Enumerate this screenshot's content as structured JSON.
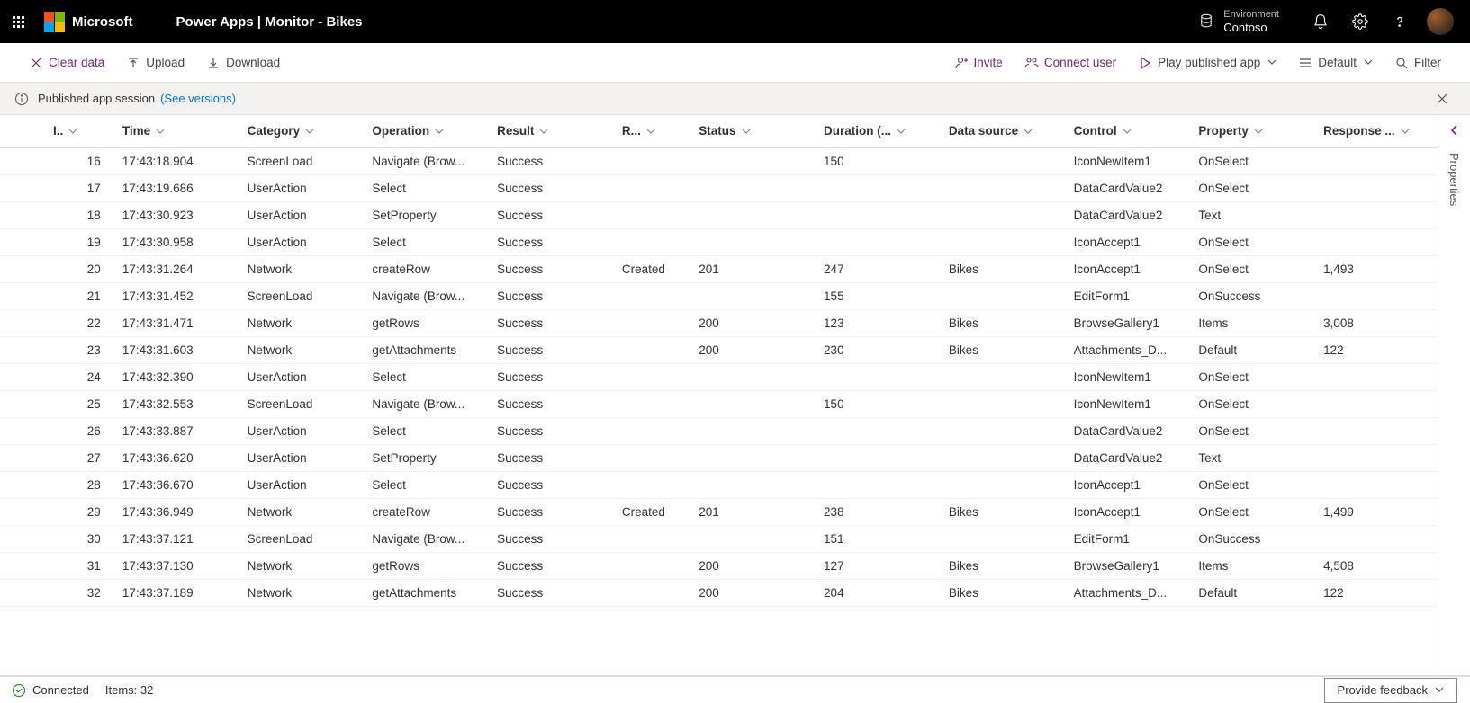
{
  "header": {
    "brand": "Microsoft",
    "app_title": "Power Apps  |  Monitor - Bikes",
    "environment_label": "Environment",
    "environment_name": "Contoso"
  },
  "command_bar": {
    "clear_data": "Clear data",
    "upload": "Upload",
    "download": "Download",
    "invite": "Invite",
    "connect_user": "Connect user",
    "play_published": "Play published app",
    "layout": "Default",
    "filter": "Filter"
  },
  "info_bar": {
    "text": "Published app session",
    "link": "(See versions)"
  },
  "properties_panel_label": "Properties",
  "table": {
    "columns": [
      {
        "key": "id",
        "label": "I.."
      },
      {
        "key": "time",
        "label": "Time"
      },
      {
        "key": "category",
        "label": "Category"
      },
      {
        "key": "operation",
        "label": "Operation"
      },
      {
        "key": "result",
        "label": "Result"
      },
      {
        "key": "resultinfo",
        "label": "R..."
      },
      {
        "key": "status",
        "label": "Status"
      },
      {
        "key": "duration",
        "label": "Duration (..."
      },
      {
        "key": "datasource",
        "label": "Data source"
      },
      {
        "key": "control",
        "label": "Control"
      },
      {
        "key": "property",
        "label": "Property"
      },
      {
        "key": "response",
        "label": "Response ..."
      }
    ],
    "rows": [
      {
        "id": "16",
        "time": "17:43:18.904",
        "category": "ScreenLoad",
        "operation": "Navigate (Brow...",
        "result": "Success",
        "resultinfo": "",
        "status": "",
        "duration": "150",
        "datasource": "",
        "control": "IconNewItem1",
        "property": "OnSelect",
        "response": ""
      },
      {
        "id": "17",
        "time": "17:43:19.686",
        "category": "UserAction",
        "operation": "Select",
        "result": "Success",
        "resultinfo": "",
        "status": "",
        "duration": "",
        "datasource": "",
        "control": "DataCardValue2",
        "property": "OnSelect",
        "response": ""
      },
      {
        "id": "18",
        "time": "17:43:30.923",
        "category": "UserAction",
        "operation": "SetProperty",
        "result": "Success",
        "resultinfo": "",
        "status": "",
        "duration": "",
        "datasource": "",
        "control": "DataCardValue2",
        "property": "Text",
        "response": ""
      },
      {
        "id": "19",
        "time": "17:43:30.958",
        "category": "UserAction",
        "operation": "Select",
        "result": "Success",
        "resultinfo": "",
        "status": "",
        "duration": "",
        "datasource": "",
        "control": "IconAccept1",
        "property": "OnSelect",
        "response": ""
      },
      {
        "id": "20",
        "time": "17:43:31.264",
        "category": "Network",
        "operation": "createRow",
        "result": "Success",
        "resultinfo": "Created",
        "status": "201",
        "duration": "247",
        "datasource": "Bikes",
        "control": "IconAccept1",
        "property": "OnSelect",
        "response": "1,493"
      },
      {
        "id": "21",
        "time": "17:43:31.452",
        "category": "ScreenLoad",
        "operation": "Navigate (Brow...",
        "result": "Success",
        "resultinfo": "",
        "status": "",
        "duration": "155",
        "datasource": "",
        "control": "EditForm1",
        "property": "OnSuccess",
        "response": ""
      },
      {
        "id": "22",
        "time": "17:43:31.471",
        "category": "Network",
        "operation": "getRows",
        "result": "Success",
        "resultinfo": "",
        "status": "200",
        "duration": "123",
        "datasource": "Bikes",
        "control": "BrowseGallery1",
        "property": "Items",
        "response": "3,008"
      },
      {
        "id": "23",
        "time": "17:43:31.603",
        "category": "Network",
        "operation": "getAttachments",
        "result": "Success",
        "resultinfo": "",
        "status": "200",
        "duration": "230",
        "datasource": "Bikes",
        "control": "Attachments_D...",
        "property": "Default",
        "response": "122"
      },
      {
        "id": "24",
        "time": "17:43:32.390",
        "category": "UserAction",
        "operation": "Select",
        "result": "Success",
        "resultinfo": "",
        "status": "",
        "duration": "",
        "datasource": "",
        "control": "IconNewItem1",
        "property": "OnSelect",
        "response": ""
      },
      {
        "id": "25",
        "time": "17:43:32.553",
        "category": "ScreenLoad",
        "operation": "Navigate (Brow...",
        "result": "Success",
        "resultinfo": "",
        "status": "",
        "duration": "150",
        "datasource": "",
        "control": "IconNewItem1",
        "property": "OnSelect",
        "response": ""
      },
      {
        "id": "26",
        "time": "17:43:33.887",
        "category": "UserAction",
        "operation": "Select",
        "result": "Success",
        "resultinfo": "",
        "status": "",
        "duration": "",
        "datasource": "",
        "control": "DataCardValue2",
        "property": "OnSelect",
        "response": ""
      },
      {
        "id": "27",
        "time": "17:43:36.620",
        "category": "UserAction",
        "operation": "SetProperty",
        "result": "Success",
        "resultinfo": "",
        "status": "",
        "duration": "",
        "datasource": "",
        "control": "DataCardValue2",
        "property": "Text",
        "response": ""
      },
      {
        "id": "28",
        "time": "17:43:36.670",
        "category": "UserAction",
        "operation": "Select",
        "result": "Success",
        "resultinfo": "",
        "status": "",
        "duration": "",
        "datasource": "",
        "control": "IconAccept1",
        "property": "OnSelect",
        "response": ""
      },
      {
        "id": "29",
        "time": "17:43:36.949",
        "category": "Network",
        "operation": "createRow",
        "result": "Success",
        "resultinfo": "Created",
        "status": "201",
        "duration": "238",
        "datasource": "Bikes",
        "control": "IconAccept1",
        "property": "OnSelect",
        "response": "1,499"
      },
      {
        "id": "30",
        "time": "17:43:37.121",
        "category": "ScreenLoad",
        "operation": "Navigate (Brow...",
        "result": "Success",
        "resultinfo": "",
        "status": "",
        "duration": "151",
        "datasource": "",
        "control": "EditForm1",
        "property": "OnSuccess",
        "response": ""
      },
      {
        "id": "31",
        "time": "17:43:37.130",
        "category": "Network",
        "operation": "getRows",
        "result": "Success",
        "resultinfo": "",
        "status": "200",
        "duration": "127",
        "datasource": "Bikes",
        "control": "BrowseGallery1",
        "property": "Items",
        "response": "4,508"
      },
      {
        "id": "32",
        "time": "17:43:37.189",
        "category": "Network",
        "operation": "getAttachments",
        "result": "Success",
        "resultinfo": "",
        "status": "200",
        "duration": "204",
        "datasource": "Bikes",
        "control": "Attachments_D...",
        "property": "Default",
        "response": "122"
      }
    ]
  },
  "status_bar": {
    "connected": "Connected",
    "items": "Items: 32",
    "feedback": "Provide feedback"
  }
}
